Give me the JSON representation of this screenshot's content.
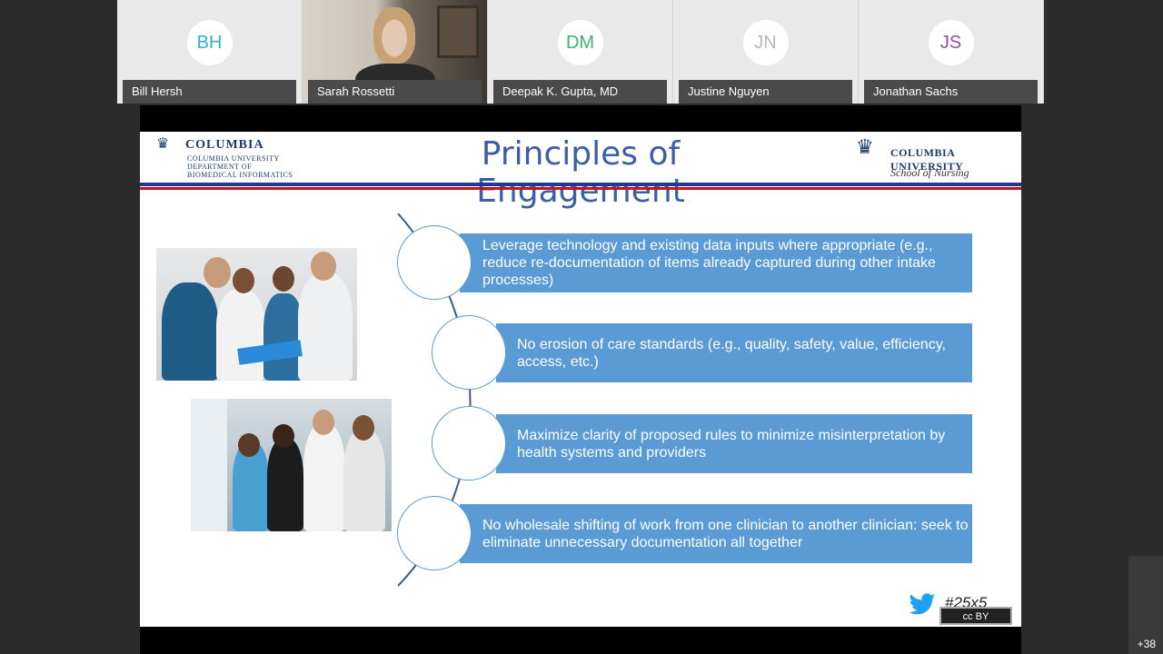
{
  "participants": [
    {
      "initials": "BH",
      "name": "Bill Hersh",
      "color": "#2bb3c9",
      "video": false
    },
    {
      "initials": "",
      "name": "Sarah Rossetti",
      "color": "",
      "video": true
    },
    {
      "initials": "DM",
      "name": "Deepak K. Gupta, MD",
      "color": "#3cb371",
      "video": false
    },
    {
      "initials": "JN",
      "name": "Justine Nguyen",
      "color": "#b8b8b8",
      "video": false
    },
    {
      "initials": "JS",
      "name": "Jonathan Sachs",
      "color": "#9b4aa6",
      "video": false
    }
  ],
  "slide": {
    "title": "Principles of Engagement",
    "logo_left": {
      "brand": "COLUMBIA",
      "line1": "COLUMBIA UNIVERSITY",
      "line2": "DEPARTMENT OF",
      "line3": "BIOMEDICAL INFORMATICS"
    },
    "logo_right": {
      "university": "COLUMBIA UNIVERSITY",
      "school": "School of Nursing"
    },
    "items": [
      "Leverage technology and existing data inputs where appropriate (e.g., reduce re-documentation of items already captured during other intake processes)",
      "No erosion of care standards (e.g., quality, safety, value, efficiency, access, etc.)",
      "Maximize clarity of proposed rules to minimize misinterpretation by health systems and providers",
      "No wholesale shifting of work from one clinician to another clinician: seek to eliminate unnecessary documentation all together"
    ],
    "hashtag": "#25x5",
    "license": "cc BY"
  },
  "more_participants": "+38"
}
